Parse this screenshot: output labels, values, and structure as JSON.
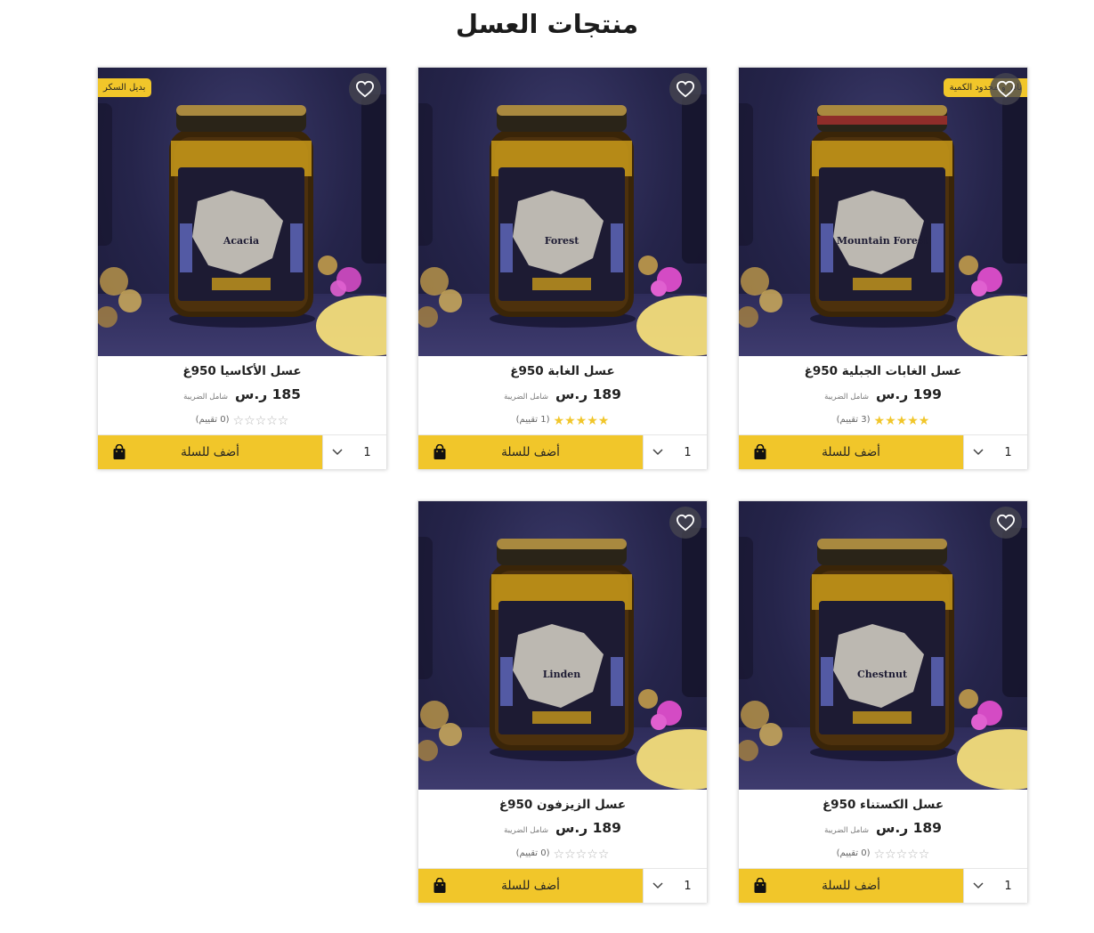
{
  "page": {
    "title": "منتجات العسل"
  },
  "common": {
    "add_to_cart": "أضف للسلة",
    "tax_note": "شامل الضريبة",
    "quantity": "1"
  },
  "colors": {
    "accent": "#f1c62a",
    "star_full": "#f1c62a",
    "star_empty": "#b5b5b5"
  },
  "products": [
    {
      "name": "عسل الغابات الجبلية 950غ",
      "price": "199 ر.س",
      "rating": 5,
      "reviews": "(3 تقييم)",
      "badge": "نادر و محدود الكمية",
      "jar_label": "Mountain Forest"
    },
    {
      "name": "عسل الغابة 950غ",
      "price": "189 ر.س",
      "rating": 5,
      "reviews": "(1 تقييم)",
      "badge": "",
      "jar_label": "Forest"
    },
    {
      "name": "عسل الأكاسيا 950غ",
      "price": "185 ر.س",
      "rating": 0,
      "reviews": "(0 تقييم)",
      "badge": "بديل السكر",
      "jar_label": "Acacia"
    },
    {
      "name": "عسل الكستناء 950غ",
      "price": "189 ر.س",
      "rating": 0,
      "reviews": "(0 تقييم)",
      "badge": "",
      "jar_label": "Chestnut"
    },
    {
      "name": "عسل الزيزفون 950غ",
      "price": "189 ر.س",
      "rating": 0,
      "reviews": "(0 تقييم)",
      "badge": "",
      "jar_label": "Linden"
    }
  ]
}
